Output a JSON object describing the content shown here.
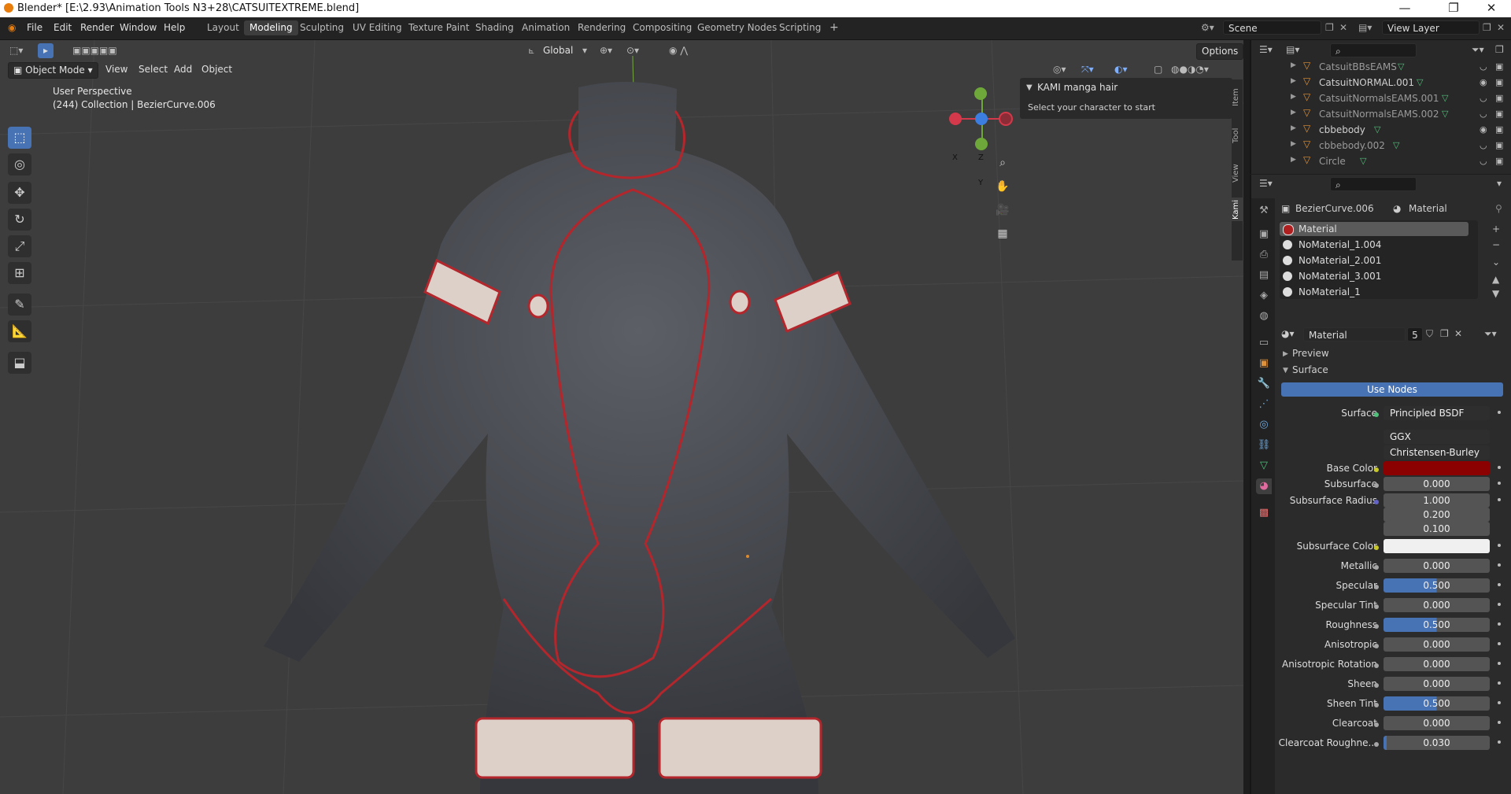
{
  "window": {
    "title": "Blender* [E:\\2.93\\Animation Tools N3+28\\CATSUITEXTREME.blend]",
    "controls": {
      "minimize": "—",
      "maximize": "❐",
      "close": "✕"
    }
  },
  "menus": [
    "File",
    "Edit",
    "Render",
    "Window",
    "Help"
  ],
  "workspaces": [
    "Layout",
    "Modeling",
    "Sculpting",
    "UV Editing",
    "Texture Paint",
    "Shading",
    "Animation",
    "Rendering",
    "Compositing",
    "Geometry Nodes",
    "Scripting"
  ],
  "active_workspace": "Modeling",
  "add_workspace": "+",
  "scene": "Scene",
  "view_layer": "View Layer",
  "viewport": {
    "mode": "Object Mode",
    "header_menus": [
      "View",
      "Select",
      "Add",
      "Object"
    ],
    "orientation": "Global",
    "options": "Options",
    "perspective_label": "User Perspective",
    "collection_label": "(244) Collection | BezierCurve.006",
    "gizmo": {
      "x": "X",
      "y": "Y",
      "z": "Z"
    },
    "kami_panel_title": "KAMI manga hair",
    "kami_panel_text": "Select your character to start",
    "n_tabs": [
      "Item",
      "Tool",
      "View",
      "Kami"
    ]
  },
  "outliner": {
    "items": [
      {
        "name": "CatsuitBBsEAMS",
        "dim": true,
        "eye": false
      },
      {
        "name": "CatsuitNORMAL.001",
        "dim": false,
        "eye": true
      },
      {
        "name": "CatsuitNormalsEAMS.001",
        "dim": true,
        "eye": false
      },
      {
        "name": "CatsuitNormalsEAMS.002",
        "dim": true,
        "eye": false
      },
      {
        "name": "cbbebody",
        "dim": false,
        "eye": true
      },
      {
        "name": "cbbebody.002",
        "dim": true,
        "eye": false
      },
      {
        "name": "Circle",
        "dim": true,
        "eye": false
      }
    ]
  },
  "properties": {
    "object": "BezierCurve.006",
    "material_tab": "Material",
    "slots": [
      "Material",
      "NoMaterial_1.004",
      "NoMaterial_2.001",
      "NoMaterial_3.001",
      "NoMaterial_1"
    ],
    "material_name": "Material",
    "user_count": "5",
    "preview_label": "Preview",
    "surface_label": "Surface",
    "use_nodes": "Use Nodes",
    "surface_shader_label": "Surface",
    "surface_shader": "Principled BSDF",
    "distribution": "GGX",
    "subsurface_method": "Christensen-Burley",
    "base_color": "#8b0000",
    "subsurface_color": "#f0f0f0",
    "fields": [
      {
        "label": "Base Color",
        "value": ""
      },
      {
        "label": "Subsurface",
        "value": "0.000"
      },
      {
        "label": "Subsurface Radius",
        "value": "1.000"
      },
      {
        "label": "",
        "value": "0.200"
      },
      {
        "label": "",
        "value": "0.100"
      },
      {
        "label": "Subsurface Color",
        "value": ""
      },
      {
        "label": "Metallic",
        "value": "0.000"
      },
      {
        "label": "Specular",
        "value": "0.500"
      },
      {
        "label": "Specular Tint",
        "value": "0.000"
      },
      {
        "label": "Roughness",
        "value": "0.500"
      },
      {
        "label": "Anisotropic",
        "value": "0.000"
      },
      {
        "label": "Anisotropic Rotation",
        "value": "0.000"
      },
      {
        "label": "Sheen",
        "value": "0.000"
      },
      {
        "label": "Sheen Tint",
        "value": "0.500"
      },
      {
        "label": "Clearcoat",
        "value": "0.000"
      },
      {
        "label": "Clearcoat Roughne...",
        "value": "0.030"
      }
    ]
  }
}
